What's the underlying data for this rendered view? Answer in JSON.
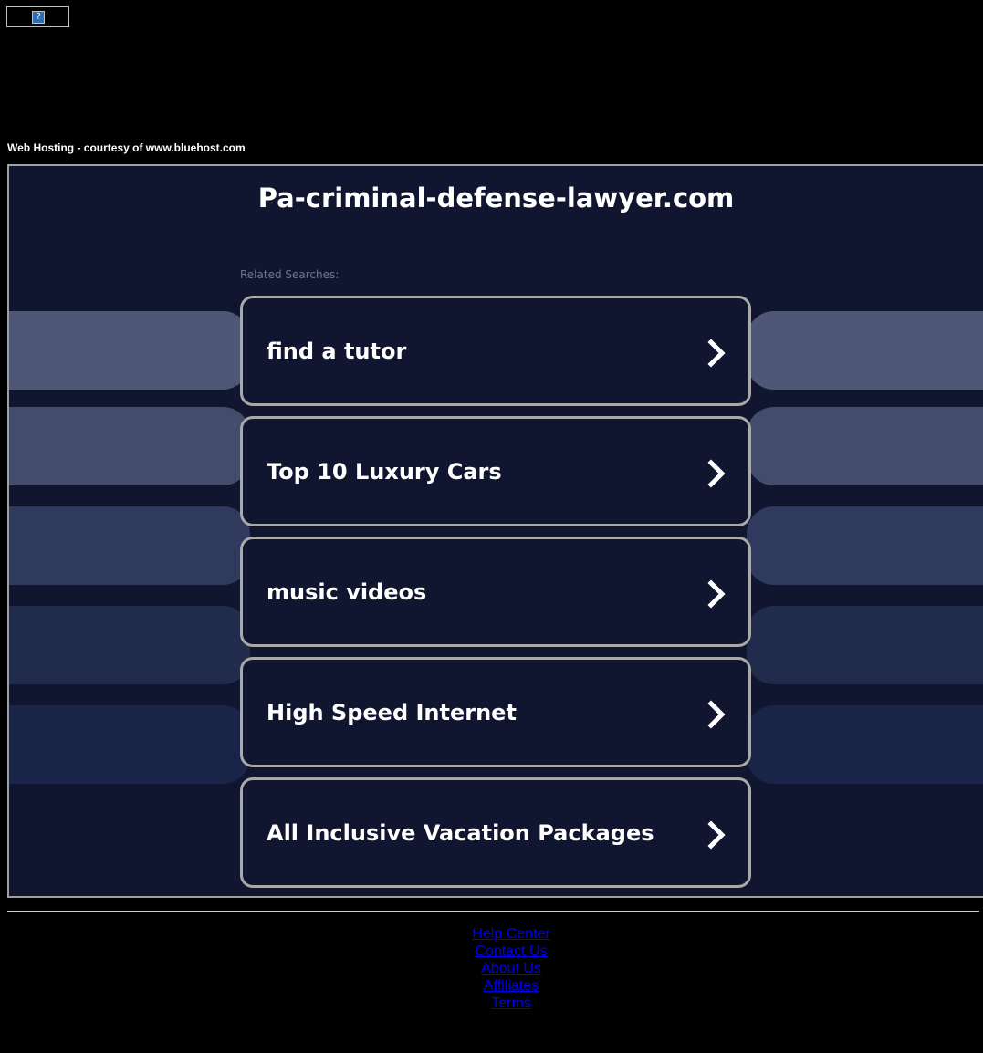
{
  "header": {
    "broken_image_glyph": "?",
    "hosting_note": "Web Hosting - courtesy of www.bluehost.com"
  },
  "main": {
    "domain_title": "Pa-criminal-defense-lawyer.com",
    "related_label": "Related Searches:",
    "searches": [
      {
        "label": "find a tutor"
      },
      {
        "label": "Top 10 Luxury Cars"
      },
      {
        "label": "music videos"
      },
      {
        "label": "High Speed Internet"
      },
      {
        "label": "All Inclusive Vacation Packages"
      }
    ]
  },
  "footer": {
    "links": [
      {
        "label": "Help Center"
      },
      {
        "label": "Contact Us"
      },
      {
        "label": "About Us"
      },
      {
        "label": "Affiliates"
      },
      {
        "label": "Terms"
      }
    ]
  },
  "icons": {
    "card_arrow": "chevron-right-icon",
    "broken_image": "broken-image-icon"
  },
  "colors": {
    "page_background": "#000000",
    "panel_background": "#101630",
    "card_border": "#a9a9a9",
    "link": "#0000ee",
    "pill_shades": [
      "#4e5775",
      "#434c6a",
      "#2f3a5e",
      "#212b4c",
      "#1a2448"
    ]
  }
}
